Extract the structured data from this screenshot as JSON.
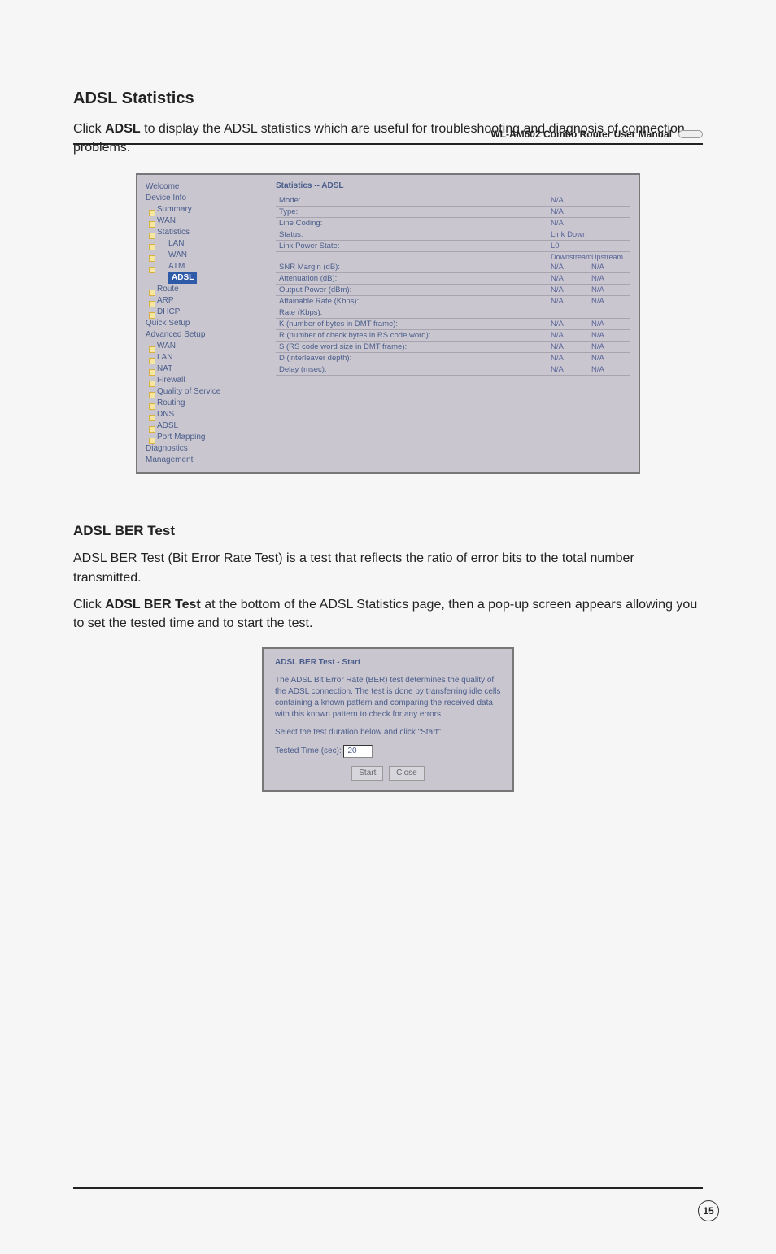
{
  "header": {
    "title": "WL-AM602 Combo Router User Manual"
  },
  "section1": {
    "title": "ADSL Statistics",
    "para1_a": "Click ",
    "para1_b": "ADSL",
    "para1_c": " to display the ADSL statistics which are useful for troubleshooting and diagnosis of connection problems."
  },
  "shot1": {
    "title": "Statistics -- ADSL",
    "tree": {
      "welcome": "Welcome",
      "device": "Device Info",
      "summary": "Summary",
      "wan": "WAN",
      "statistics": "Statistics",
      "lan": "LAN",
      "wan2": "WAN",
      "atm": "ATM",
      "adsl": "ADSL",
      "route": "Route",
      "arp": "ARP",
      "dhcp": "DHCP",
      "quick": "Quick Setup",
      "adv": "Advanced Setup",
      "wan3": "WAN",
      "lan2": "LAN",
      "nat": "NAT",
      "firewall": "Firewall",
      "qos": "Quality of Service",
      "routing": "Routing",
      "dns": "DNS",
      "adsl2": "ADSL",
      "portmap": "Port Mapping",
      "diag": "Diagnostics",
      "mgmt": "Management"
    },
    "rows_single": [
      {
        "label": "Mode:",
        "v": "N/A"
      },
      {
        "label": "Type:",
        "v": "N/A"
      },
      {
        "label": "Line Coding:",
        "v": "N/A"
      },
      {
        "label": "Status:",
        "v": "Link Down"
      },
      {
        "label": "Link Power State:",
        "v": "L0"
      }
    ],
    "hdr": {
      "down": "Downstream",
      "up": "Upstream"
    },
    "rows_dual": [
      {
        "label": "SNR Margin (dB):",
        "d": "N/A",
        "u": "N/A"
      },
      {
        "label": "Attenuation (dB):",
        "d": "N/A",
        "u": "N/A"
      },
      {
        "label": "Output Power (dBm):",
        "d": "N/A",
        "u": "N/A"
      },
      {
        "label": "Attainable Rate (Kbps):",
        "d": "N/A",
        "u": "N/A"
      },
      {
        "label": "Rate (Kbps):",
        "d": "",
        "u": ""
      },
      {
        "label": "K (number of bytes in DMT frame):",
        "d": "N/A",
        "u": "N/A"
      },
      {
        "label": "R (number of check bytes in RS code word):",
        "d": "N/A",
        "u": "N/A"
      },
      {
        "label": "S (RS code word size in DMT frame):",
        "d": "N/A",
        "u": "N/A"
      },
      {
        "label": "D (interleaver depth):",
        "d": "N/A",
        "u": "N/A"
      },
      {
        "label": "Delay (msec):",
        "d": "N/A",
        "u": "N/A"
      }
    ]
  },
  "section2": {
    "title": "ADSL BER Test",
    "para1": "ADSL BER Test (Bit Error Rate Test) is a test that reflects the ratio of error bits to the total number transmitted.",
    "para2_a": "Click ",
    "para2_b": "ADSL BER Test",
    "para2_c": " at the bottom of the ADSL Statistics page, then a pop-up screen appears allowing you to set the tested time and to start the test."
  },
  "shot2": {
    "title": "ADSL BER Test - Start",
    "body": "The ADSL Bit Error Rate (BER) test determines the quality of the ADSL connection. The test is done by transferring idle cells containing a known pattern and comparing the received data with this known pattern to check for any errors.",
    "select_label": "Select the test duration below and click \"Start\".",
    "tested_label": "Tested Time (sec):",
    "tested_value": "20",
    "start": "Start",
    "close": "Close"
  },
  "page": "15"
}
